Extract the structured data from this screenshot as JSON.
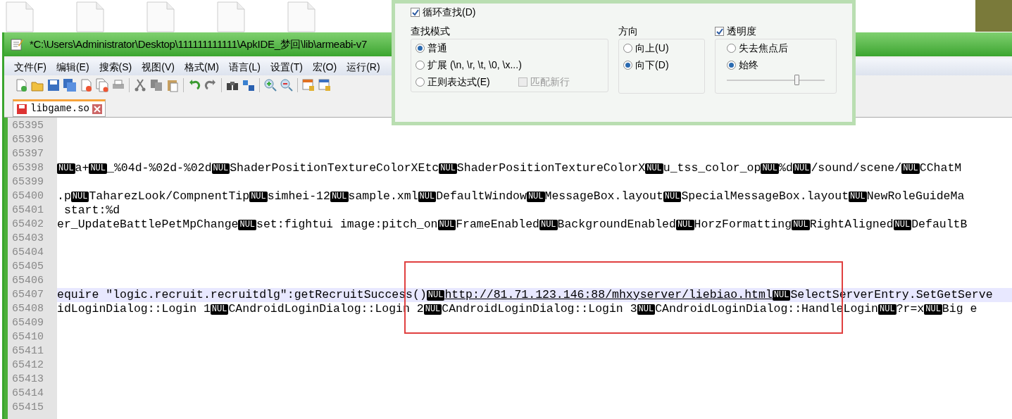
{
  "window": {
    "title": "*C:\\Users\\Administrator\\Desktop\\111111111111\\ApkIDE_梦回\\lib\\armeabi-v7",
    "menu": [
      "文件(F)",
      "编辑(E)",
      "搜索(S)",
      "视图(V)",
      "格式(M)",
      "语言(L)",
      "设置(T)",
      "宏(O)",
      "运行(R)"
    ],
    "tab": {
      "label": "libgame.so",
      "selected": true
    },
    "editor": {
      "lines": [
        {
          "number": "65395",
          "highlighted": false
        },
        {
          "number": "65396",
          "highlighted": false
        },
        {
          "number": "65397",
          "highlighted": false
        },
        {
          "number": "65398",
          "highlighted": false,
          "segments": [
            {
              "kind": "nul",
              "text": "NUL"
            },
            {
              "kind": "text",
              "text": "a+"
            },
            {
              "kind": "nul",
              "text": "NUL"
            },
            {
              "kind": "text",
              "text": "_%04d-%02d-%02d"
            },
            {
              "kind": "nul",
              "text": "NUL"
            },
            {
              "kind": "text",
              "text": "ShaderPositionTextureColorXEtc"
            },
            {
              "kind": "nul",
              "text": "NUL"
            },
            {
              "kind": "text",
              "text": "ShaderPositionTextureColorX"
            },
            {
              "kind": "nul",
              "text": "NUL"
            },
            {
              "kind": "text",
              "text": "u_tss_color_op"
            },
            {
              "kind": "nul",
              "text": "NUL"
            },
            {
              "kind": "text",
              "text": "%d"
            },
            {
              "kind": "nul",
              "text": "NUL"
            },
            {
              "kind": "text",
              "text": "/sound/scene/"
            },
            {
              "kind": "nul",
              "text": "NUL"
            },
            {
              "kind": "text",
              "text": "CChatM"
            }
          ]
        },
        {
          "number": "65399",
          "highlighted": false
        },
        {
          "number": "65400",
          "highlighted": false,
          "segments": [
            {
              "kind": "text",
              "text": ".p"
            },
            {
              "kind": "nul",
              "text": "NUL"
            },
            {
              "kind": "text",
              "text": "TaharezLook/CompnentTip"
            },
            {
              "kind": "nul",
              "text": "NUL"
            },
            {
              "kind": "text",
              "text": "simhei-12"
            },
            {
              "kind": "nul",
              "text": "NUL"
            },
            {
              "kind": "text",
              "text": "sample.xml"
            },
            {
              "kind": "nul",
              "text": "NUL"
            },
            {
              "kind": "text",
              "text": "DefaultWindow"
            },
            {
              "kind": "nul",
              "text": "NUL"
            },
            {
              "kind": "text",
              "text": "MessageBox.layout"
            },
            {
              "kind": "nul",
              "text": "NUL"
            },
            {
              "kind": "text",
              "text": "SpecialMessageBox.layout"
            },
            {
              "kind": "nul",
              "text": "NUL"
            },
            {
              "kind": "text",
              "text": "NewRoleGuideMa"
            }
          ]
        },
        {
          "number": "65401",
          "highlighted": false,
          "segments": [
            {
              "kind": "text",
              "text": " start:%d"
            }
          ]
        },
        {
          "number": "65402",
          "highlighted": false,
          "segments": [
            {
              "kind": "text",
              "text": "er_UpdateBattlePetMpChange"
            },
            {
              "kind": "nul",
              "text": "NUL"
            },
            {
              "kind": "text",
              "text": "set:fightui image:pitch_on"
            },
            {
              "kind": "nul",
              "text": "NUL"
            },
            {
              "kind": "text",
              "text": "FrameEnabled"
            },
            {
              "kind": "nul",
              "text": "NUL"
            },
            {
              "kind": "text",
              "text": "BackgroundEnabled"
            },
            {
              "kind": "nul",
              "text": "NUL"
            },
            {
              "kind": "text",
              "text": "HorzFormatting"
            },
            {
              "kind": "nul",
              "text": "NUL"
            },
            {
              "kind": "text",
              "text": "RightAligned"
            },
            {
              "kind": "nul",
              "text": "NUL"
            },
            {
              "kind": "text",
              "text": "DefaultB"
            }
          ]
        },
        {
          "number": "65403",
          "highlighted": false
        },
        {
          "number": "65404",
          "highlighted": false
        },
        {
          "number": "65405",
          "highlighted": false
        },
        {
          "number": "65406",
          "highlighted": false
        },
        {
          "number": "65407",
          "highlighted": true,
          "segments": [
            {
              "kind": "text",
              "text": "equire \"logic.recruit.recruitdlg\":getRecruitSuccess()"
            },
            {
              "kind": "nul",
              "text": "NUL"
            },
            {
              "kind": "link",
              "text": "http://81.71.123.146:88/mhxyserver/liebiao.html"
            },
            {
              "kind": "nul",
              "text": "NUL"
            },
            {
              "kind": "text",
              "text": "SelectServerEntry.SetGetServe"
            }
          ]
        },
        {
          "number": "65408",
          "highlighted": false,
          "segments": [
            {
              "kind": "text",
              "text": "idLoginDialog::Login 1"
            },
            {
              "kind": "nul",
              "text": "NUL"
            },
            {
              "kind": "text",
              "text": "CAndroidLoginDialog::Login 2"
            },
            {
              "kind": "nul",
              "text": "NUL"
            },
            {
              "kind": "text",
              "text": "CAndroidLoginDialog::Login 3"
            },
            {
              "kind": "nul",
              "text": "NUL"
            },
            {
              "kind": "text",
              "text": "CAndroidLoginDialog::HandleLogin"
            },
            {
              "kind": "nul",
              "text": "NUL"
            },
            {
              "kind": "text",
              "text": "?r=x"
            },
            {
              "kind": "nul",
              "text": "NUL"
            },
            {
              "kind": "text",
              "text": "Big e"
            }
          ]
        },
        {
          "number": "65409",
          "highlighted": false
        },
        {
          "number": "65410",
          "highlighted": false
        },
        {
          "number": "65411",
          "highlighted": false
        },
        {
          "number": "65412",
          "highlighted": false
        },
        {
          "number": "65413",
          "highlighted": false
        },
        {
          "number": "65414",
          "highlighted": false
        },
        {
          "number": "65415",
          "highlighted": false
        }
      ]
    }
  },
  "find_dialog": {
    "wrap_around": {
      "label": "循环查找(D)",
      "checked": true
    },
    "search_mode": {
      "title": "查找模式",
      "options": [
        {
          "label": "普通",
          "selected": true
        },
        {
          "label": "扩展 (\\n, \\r, \\t, \\0, \\x...)",
          "selected": false
        },
        {
          "label": "正则表达式(E)",
          "selected": false
        }
      ]
    },
    "match_newline": {
      "label": "匹配新行",
      "checked": false,
      "disabled": true
    },
    "direction": {
      "title": "方向",
      "options": [
        {
          "label": "向上(U)",
          "selected": false
        },
        {
          "label": "向下(D)",
          "selected": true
        }
      ]
    },
    "transparency": {
      "label": "透明度",
      "checked": true,
      "options": [
        {
          "label": "失去焦点后",
          "selected": false
        },
        {
          "label": "始终",
          "selected": true
        }
      ],
      "level": 0.71
    }
  }
}
